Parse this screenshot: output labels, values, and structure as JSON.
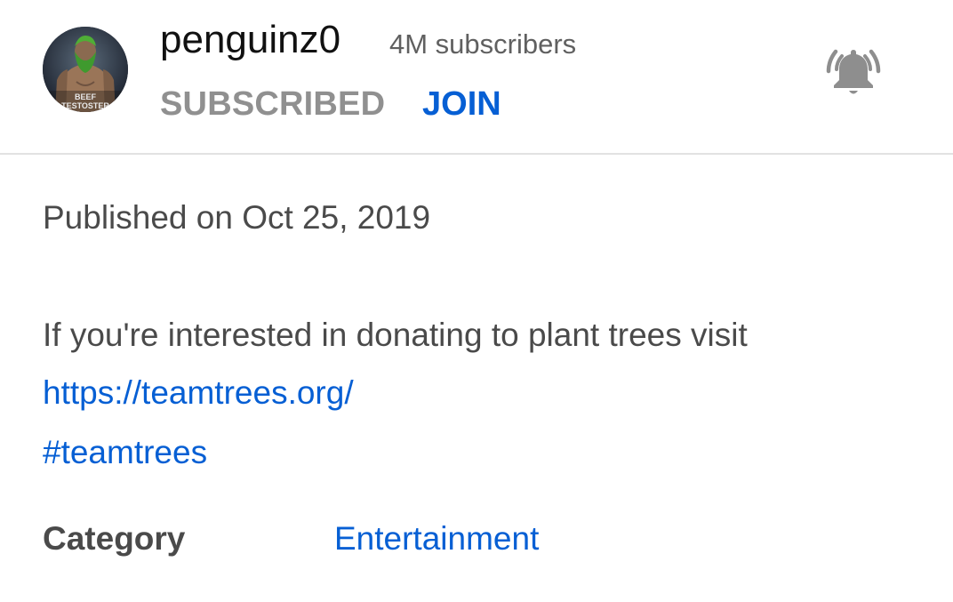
{
  "channel": {
    "name": "penguinz0",
    "subscribers": "4M subscribers",
    "avatar_text": "BEEF\nTESTOSTERONE"
  },
  "actions": {
    "subscribed_label": "SUBSCRIBED",
    "join_label": "JOIN",
    "notification_icon": "bell-ringing-icon"
  },
  "description": {
    "published": "Published on Oct 25, 2019",
    "text": "If you're interested in donating to plant trees visit",
    "link": "https://teamtrees.org/",
    "hashtag": "#teamtrees"
  },
  "metadata": {
    "category_label": "Category",
    "category_value": "Entertainment"
  },
  "colors": {
    "link": "#065fd4",
    "muted": "#909090",
    "text": "#4a4a4a",
    "title": "#111111"
  }
}
